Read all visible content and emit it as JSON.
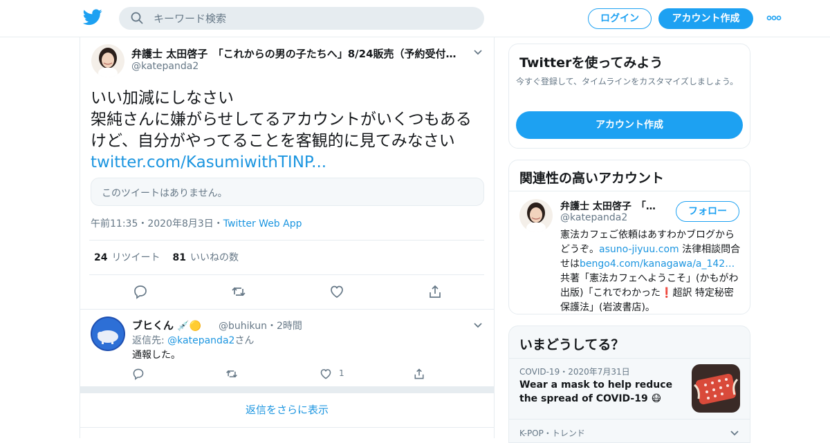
{
  "header": {
    "search_placeholder": "キーワード検索",
    "login_label": "ログイン",
    "signup_label": "アカウント作成"
  },
  "tweet": {
    "author_name": "弁護士 太田啓子　「これからの男の子たちへ」8/24販売（予約受付…",
    "author_handle": "@katepanda2",
    "text_line1": "いい加減にしなさい",
    "text_body": "架純さんに嫌がらせしてるアカウントがいくつもあるけど、自分がやってることを客観的に見てみなさい ",
    "text_link": "twitter.com/KasumiwithTINP...",
    "quote_unavailable": "このツイートはありません。",
    "time": "午前11:35・2020年8月3日・",
    "source": "Twitter Web App",
    "retweet_count": "24",
    "retweet_label": "リツイート",
    "like_count": "81",
    "like_label": "いいねの数"
  },
  "reply": {
    "author_name": "ブヒくん",
    "author_emoji": "💉🟡",
    "author_handle": "@buhikun・2時間",
    "reply_to_prefix": "返信先: ",
    "reply_to_handle": "@katepanda2",
    "reply_to_suffix": "さん",
    "text": "通報した。",
    "like_count": "1"
  },
  "show_more_replies": "返信をさらに表示",
  "sidebar": {
    "try_title": "Twitterを使ってみよう",
    "try_subtitle": "今すぐ登録して、タイムラインをカスタマイズしましょう。",
    "try_button": "アカウント作成",
    "related_title": "関連性の高いアカウント",
    "related_name": "弁護士 太田啓子　「…",
    "related_handle": "@katepanda2",
    "follow_label": "フォロー",
    "bio_part1": "憲法カフェご依頼はあすわかブログからどうぞ。",
    "bio_link1": "asuno-jiyuu.com",
    "bio_part2": " 法律相談問合せは",
    "bio_link2": "bengo4.com/kanagawa/a_142…",
    "bio_part3": " 共著「憲法カフェへようこそ」(かもがわ出版)「これでわかった",
    "bio_excl": "❗",
    "bio_part4": "超訳 特定秘密保護法」(岩波書店)。",
    "trends_title": "いまどうしてる？",
    "trend1_meta": "COVID-19・2020年7月31日",
    "trend1_text": "Wear a mask to help reduce the spread of COVID-19 😷",
    "trend2_meta": "K-POP・トレンド"
  },
  "colors": {
    "accent": "#1da1f2",
    "link": "#1b95e0",
    "muted": "#657786",
    "border": "#e6ecf0"
  }
}
